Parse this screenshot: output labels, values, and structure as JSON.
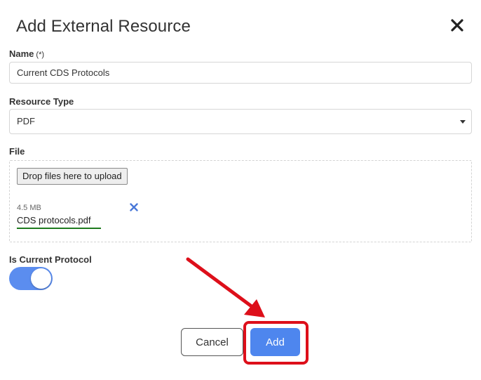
{
  "dialog": {
    "title": "Add External Resource",
    "close_icon": "close-icon"
  },
  "fields": {
    "name": {
      "label": "Name",
      "required_marker": "(*)",
      "value": "Current CDS Protocols"
    },
    "resource_type": {
      "label": "Resource Type",
      "selected": "PDF"
    },
    "file": {
      "label": "File",
      "upload_button": "Drop files here to upload",
      "uploaded": {
        "size": "4.5 MB",
        "name": "CDS protocols.pdf"
      },
      "remove_icon": "remove-x-icon"
    },
    "is_current_protocol": {
      "label": "Is Current Protocol",
      "enabled": true
    }
  },
  "actions": {
    "cancel_label": "Cancel",
    "add_label": "Add"
  },
  "colors": {
    "primary": "#4e86ee",
    "toggle_on": "#5b8def",
    "annotation_red": "#dd0f1a",
    "file_underline": "#1e7a1e",
    "remove_x": "#4a78d8"
  }
}
